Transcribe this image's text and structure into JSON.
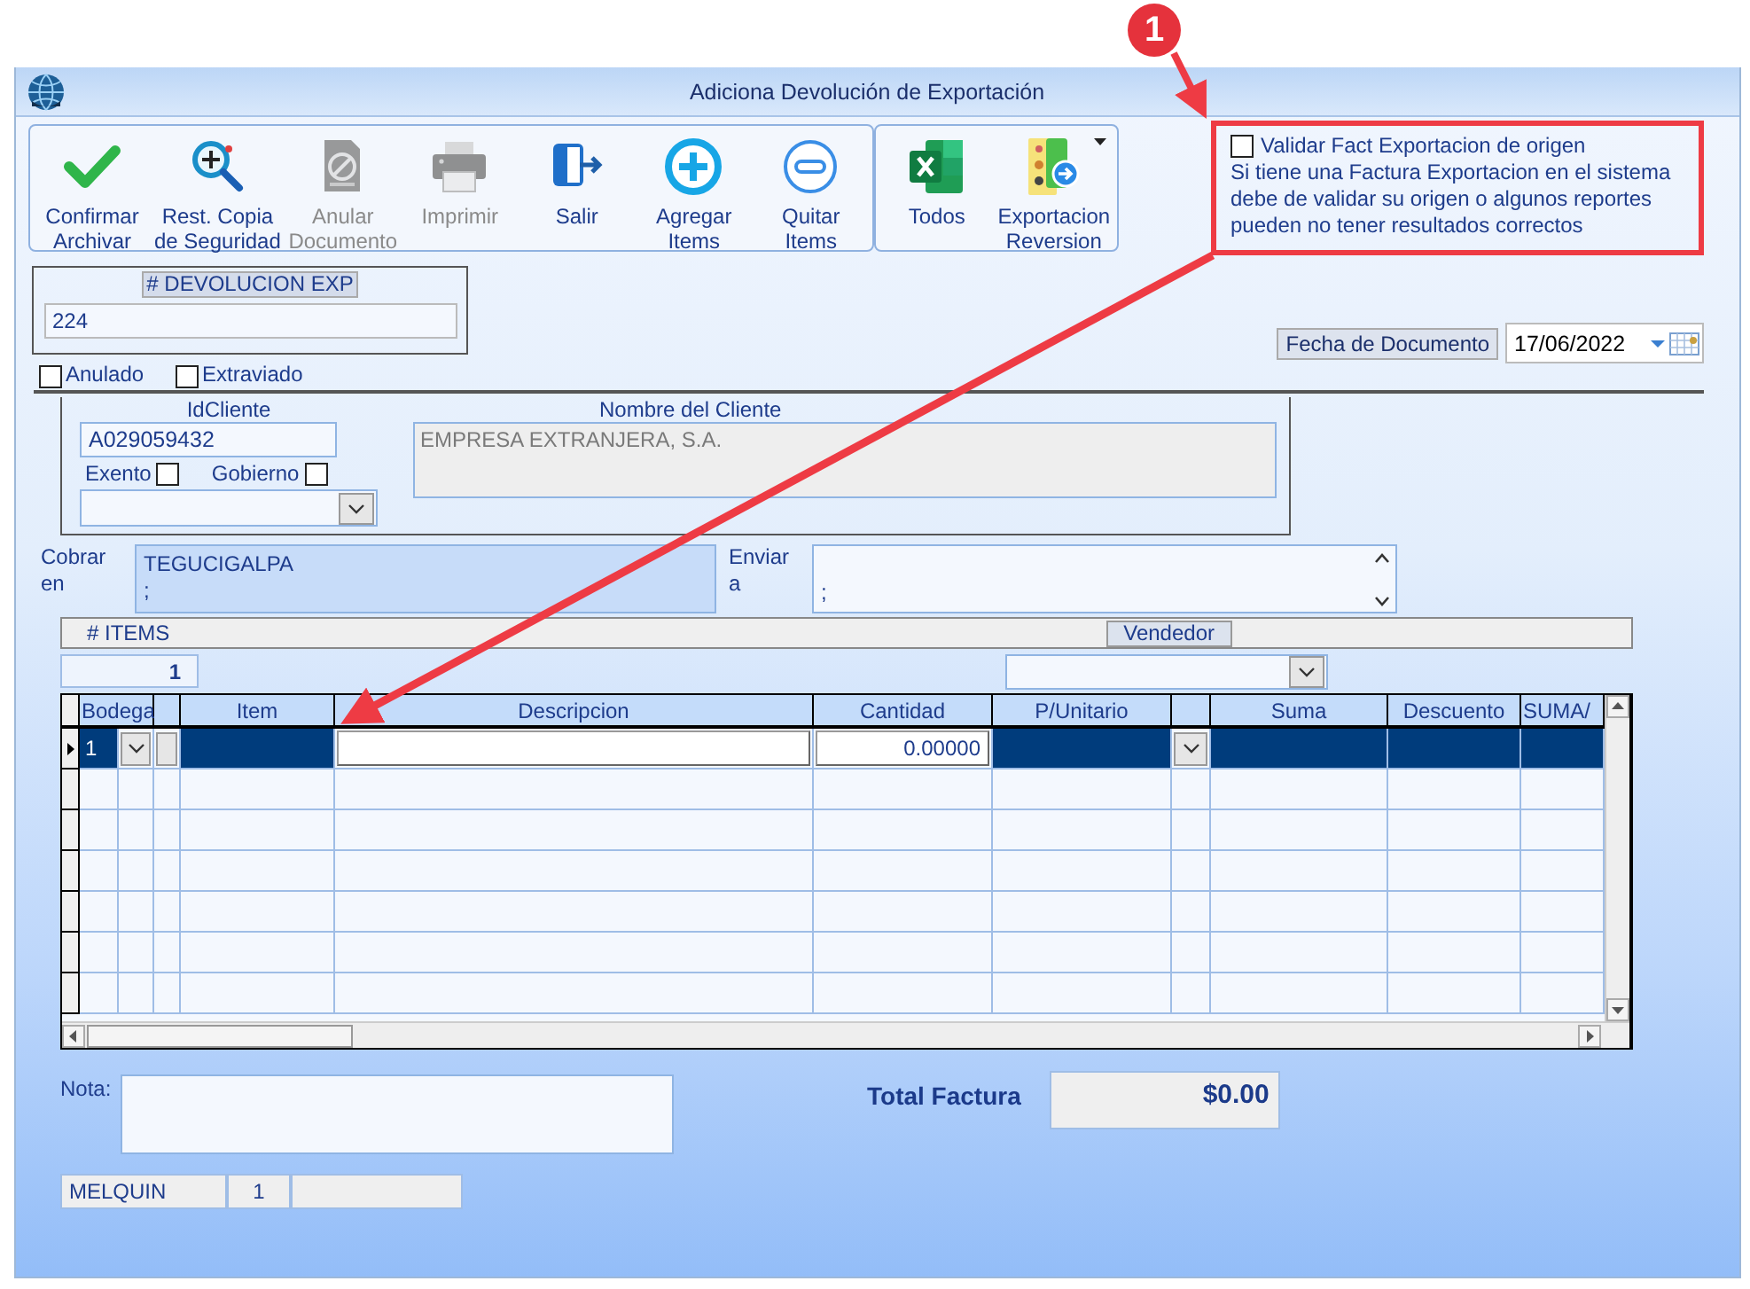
{
  "window": {
    "title": "Adiciona Devolución de Exportación"
  },
  "toolbar": [
    {
      "label": "Confirmar\nArchivar",
      "kind": "confirm",
      "disabled": false
    },
    {
      "label": "Rest. Copia\nde Seguridad",
      "kind": "restore",
      "disabled": false
    },
    {
      "label": "Anular\nDocumento",
      "kind": "void",
      "disabled": true
    },
    {
      "label": "Imprimir",
      "kind": "print",
      "disabled": true
    },
    {
      "label": "Salir",
      "kind": "exit",
      "disabled": false
    },
    {
      "label": "Agregar\nItems",
      "kind": "add",
      "disabled": false
    },
    {
      "label": "Quitar\nItems",
      "kind": "remove",
      "disabled": false
    }
  ],
  "toolbar_2": [
    {
      "label": "Todos",
      "kind": "excel",
      "disabled": false
    },
    {
      "label": "Exportacion\nReversion",
      "kind": "export",
      "disabled": false
    }
  ],
  "validation": {
    "label": "Validar Fact Exportacion de origen",
    "checked": false,
    "note": "Si tiene una Factura Exportacion en el sistema\ndebe de validar su origen o algunos reportes\npueden no tener resultados correctos"
  },
  "document": {
    "number_label": "# DEVOLUCION EXP",
    "number": "224",
    "date_label": "Fecha de  Documento",
    "date": "17/06/2022"
  },
  "flags": [
    {
      "label": "Anulado",
      "checked": false
    },
    {
      "label": "Extraviado",
      "checked": false
    }
  ],
  "client": {
    "id_label": "IdCliente",
    "id": "A029059432",
    "name_label": "Nombre del Cliente",
    "name": "EMPRESA EXTRANJERA, S.A.",
    "options": [
      {
        "label": "Exento",
        "checked": false
      },
      {
        "label": "Gobierno",
        "checked": false
      }
    ]
  },
  "billing": {
    "label": "Cobrar\nen",
    "lines": [
      "TEGUCIGALPA",
      ";"
    ]
  },
  "shipping": {
    "label": "Enviar\na",
    "lines": [
      ";"
    ]
  },
  "items_bar": {
    "label": "# ITEMS",
    "count": "1",
    "vendor_label": "Vendedor"
  },
  "table": {
    "columns": [
      "Bodega",
      "Item",
      "Descripcion",
      "Cantidad",
      "P/Unitario",
      "Suma",
      "Descuento",
      "SUMA/"
    ],
    "rows": [
      {
        "selected": true,
        "bodega": "1",
        "cantidad": "0.00000"
      }
    ]
  },
  "footer": {
    "note_label": "Nota:",
    "total_label": "Total Factura",
    "total": "$0.00",
    "status": [
      "MELQUIN",
      "1"
    ]
  },
  "annotation": {
    "badge": "1"
  }
}
